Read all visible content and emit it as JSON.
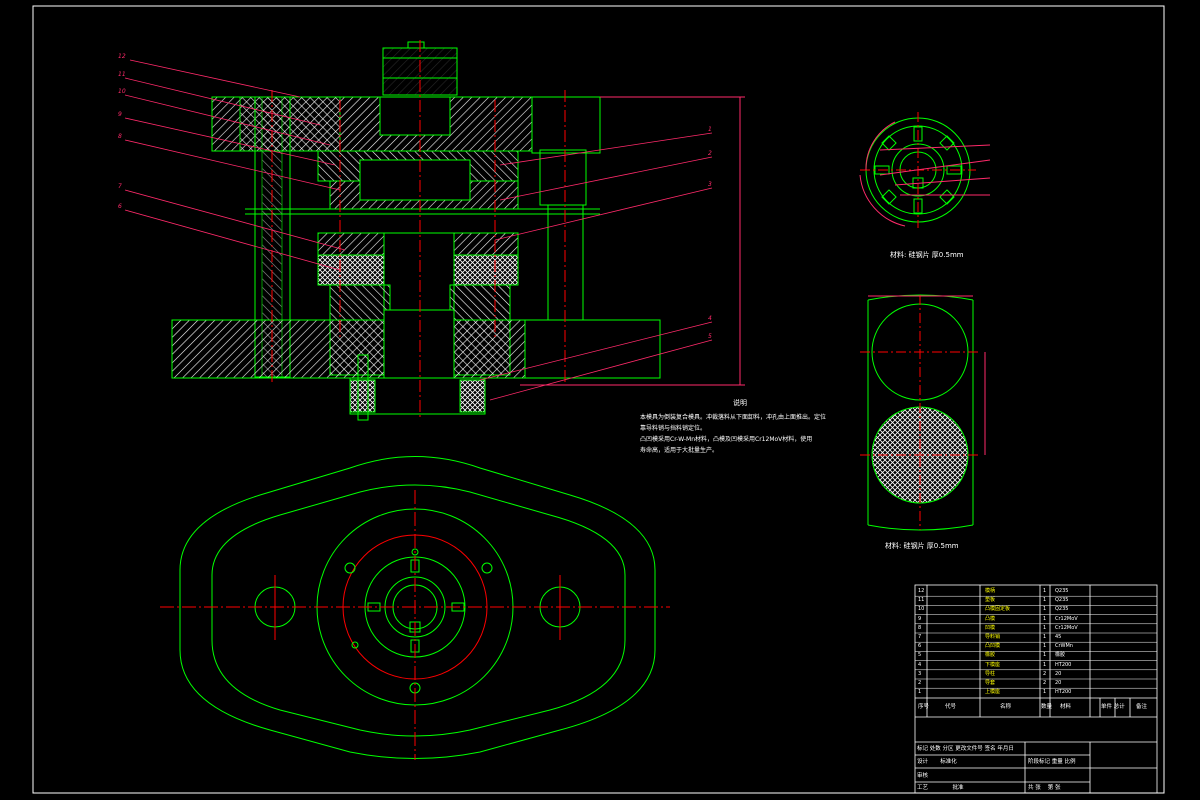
{
  "notes": {
    "title": "说明",
    "lines": [
      "本模具为倒装复合模具。冲裁落料从下面卸料，冲孔由上面推出。定位",
      "靠导料销与挡料销定位。",
      "凸凹模采用Cr-W-Mn材料，凸模及凹模采用Cr12MoV材料，使用",
      "寿命高，适用于大批量生产。"
    ]
  },
  "captions": {
    "part": "材料: 硅钢片  厚0.5mm",
    "strip": "材料: 硅钢片  厚0.5mm"
  },
  "callouts": [
    "12",
    "11",
    "10",
    "9",
    "8",
    "7",
    "6",
    "1",
    "2",
    "3",
    "4",
    "5"
  ],
  "bom": {
    "rows": [
      {
        "no": "12",
        "name": "模柄",
        "qty": "1",
        "mat": "Q235"
      },
      {
        "no": "11",
        "name": "垫板",
        "qty": "1",
        "mat": "Q235"
      },
      {
        "no": "10",
        "name": "凸模固定板",
        "qty": "1",
        "mat": "Q235"
      },
      {
        "no": "9",
        "name": "凸模",
        "qty": "1",
        "mat": "Cr12MoV"
      },
      {
        "no": "8",
        "name": "凹模",
        "qty": "1",
        "mat": "Cr12MoV"
      },
      {
        "no": "7",
        "name": "导料销",
        "qty": "1",
        "mat": "45"
      },
      {
        "no": "6",
        "name": "凸凹模",
        "qty": "1",
        "mat": "CrWMn"
      },
      {
        "no": "5",
        "name": "橡胶",
        "qty": "1",
        "mat": "橡胶"
      },
      {
        "no": "4",
        "name": "下模座",
        "qty": "1",
        "mat": "HT200"
      },
      {
        "no": "3",
        "name": "导柱",
        "qty": "2",
        "mat": "20"
      },
      {
        "no": "2",
        "name": "导套",
        "qty": "2",
        "mat": "20"
      },
      {
        "no": "1",
        "name": "上模座",
        "qty": "1",
        "mat": "HT200"
      }
    ],
    "header": {
      "no": "序号",
      "code": "代号",
      "name": "名称",
      "qty": "数量",
      "mat": "材料",
      "weight": "单件 总计",
      "remark": "备注"
    }
  },
  "title_block": {
    "row1": [
      "标记",
      "处数",
      "分区",
      "更改文件号",
      "签名",
      "年月日"
    ],
    "row2": [
      "设计",
      "",
      "标准化",
      "",
      "阶段标记",
      "重量",
      "比例"
    ],
    "row3": [
      "审核",
      "",
      "",
      ""
    ],
    "row4": [
      "工艺",
      "",
      "批准",
      "",
      "共 张",
      "第 张"
    ]
  },
  "colors": {
    "outline": "#00ff00",
    "center": "#ff0000",
    "leader": "#ff2a6a",
    "hatch": "#ffffff",
    "text": "#ffffff",
    "frame": "#ffffff"
  }
}
